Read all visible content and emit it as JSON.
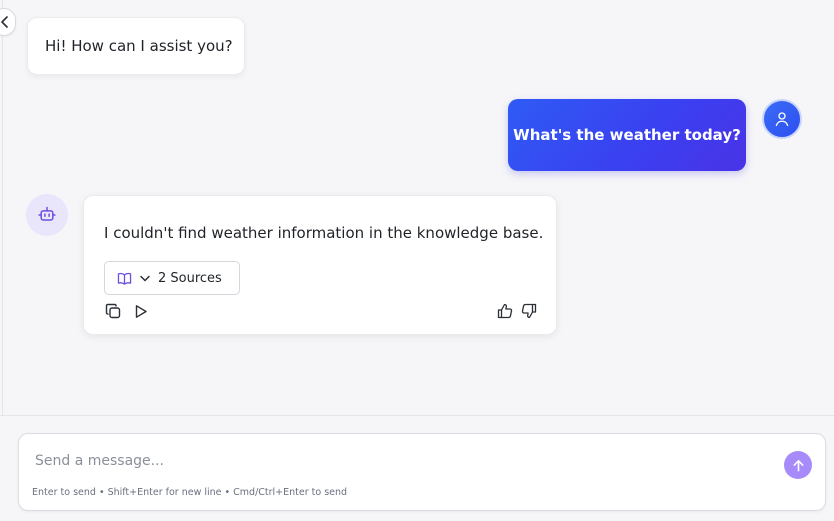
{
  "chat": {
    "messages": [
      {
        "role": "assistant",
        "text": "Hi! How can I assist you?"
      },
      {
        "role": "user",
        "text": "What's the weather today?"
      },
      {
        "role": "assistant",
        "text": "I couldn't find weather information in the knowledge base.",
        "sources_label": "2 Sources"
      }
    ]
  },
  "composer": {
    "placeholder": "Send a message...",
    "hint": "Enter to send • Shift+Enter for new line • Cmd/Ctrl+Enter to send"
  },
  "icons": {
    "collapse": "chevron-left-icon",
    "user_avatar": "user-icon",
    "bot_avatar": "robot-icon",
    "sources": "book-icon",
    "sources_toggle": "chevron-down-icon",
    "copy": "copy-icon",
    "play": "play-icon",
    "like": "thumbs-up-icon",
    "dislike": "thumbs-down-icon",
    "send": "arrow-up-icon"
  },
  "colors": {
    "user_bubble": "#3b3ff0",
    "bot_avatar_bg": "#e9e5fb",
    "send_button": "#a78bfa",
    "accent_icon": "#6d4fe0"
  }
}
